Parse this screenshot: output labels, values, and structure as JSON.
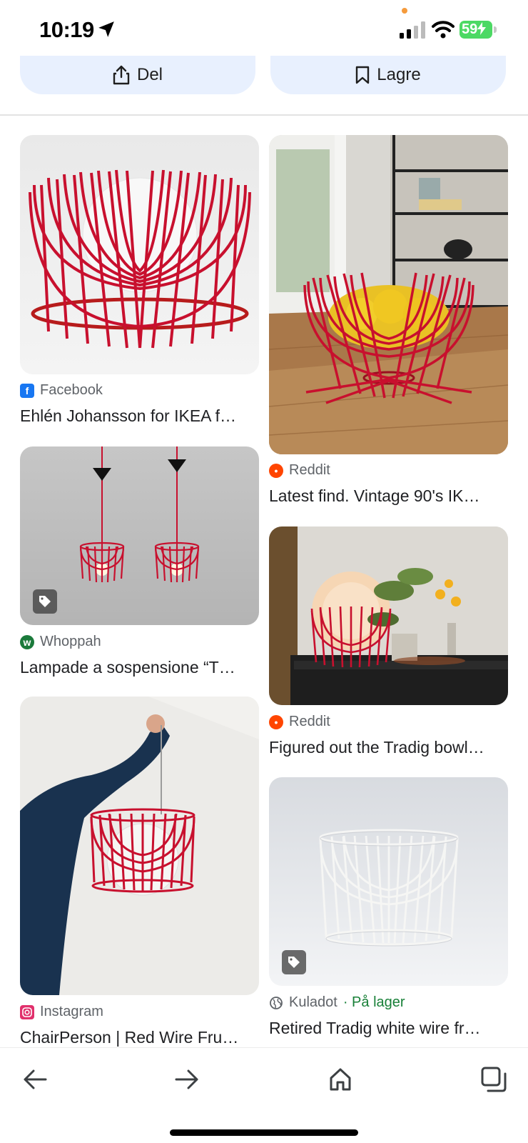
{
  "status_bar": {
    "time": "10:19",
    "battery": "59"
  },
  "actions": {
    "share_label": "Del",
    "save_label": "Lagre"
  },
  "results": [
    {
      "source": "Facebook",
      "title": "Ehlén Johansson for IKEA f…"
    },
    {
      "source": "Reddit",
      "title": "Latest find. Vintage 90's IK…"
    },
    {
      "source": "Whoppah",
      "title": "Lampade a sospensione “T…"
    },
    {
      "source": "Reddit",
      "title": "Figured out the Tradig bowl…"
    },
    {
      "source": "Instagram",
      "title": "ChairPerson | Red Wire Fru…"
    },
    {
      "source": "Kuladot",
      "availability": "· På lager",
      "title": "Retired Tradig white wire fr…"
    }
  ],
  "colors": {
    "accent_pill": "#e8f0fe",
    "wire_red": "#c8102e",
    "in_stock": "#188038"
  }
}
